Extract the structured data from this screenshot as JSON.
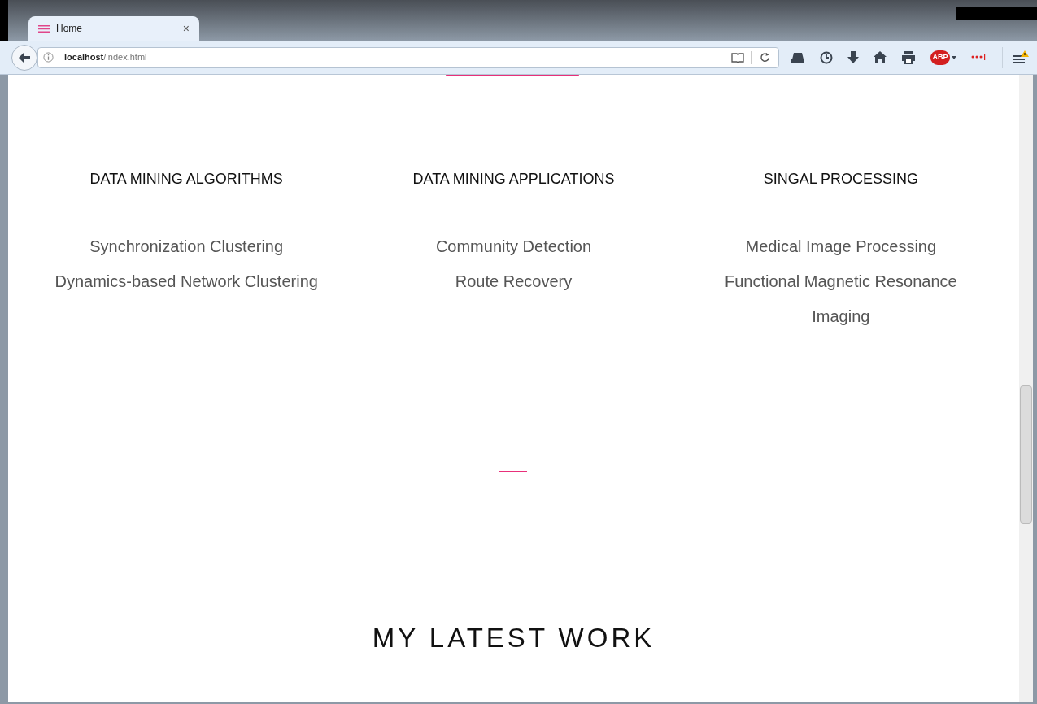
{
  "tab": {
    "title": "Home",
    "selected": true,
    "close": "×"
  },
  "address": {
    "host": "localhost",
    "path": "/index.html"
  },
  "toolbar": {
    "adblock_label": "ABP"
  },
  "columns": [
    {
      "heading": "DATA MINING ALGORITHMS",
      "items": [
        "Synchronization Clustering",
        "Dynamics-based Network Clustering"
      ]
    },
    {
      "heading": "DATA MINING APPLICATIONS",
      "items": [
        "Community Detection",
        "Route Recovery"
      ]
    },
    {
      "heading": "SINGAL PROCESSING",
      "items": [
        "Medical Image Processing",
        "Functional Magnetic Resonance Imaging"
      ]
    }
  ],
  "section_title": "MY LATEST WORK"
}
